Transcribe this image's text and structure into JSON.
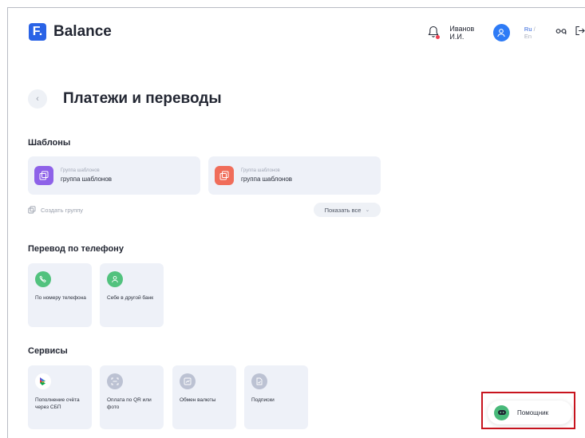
{
  "header": {
    "logo_letter": "F.",
    "logo_text": "Balance",
    "user_name": "Иванов И.И.",
    "lang_active": "Ru",
    "lang_sep": "/",
    "lang_inactive": "En"
  },
  "page": {
    "back_glyph": "‹",
    "title": "Платежи и переводы"
  },
  "templates": {
    "section_title": "Шаблоны",
    "cards": [
      {
        "sublabel": "Группа шаблонов",
        "label": "группа шаблонов",
        "icon": "template-group-icon",
        "color": "#8e62e8"
      },
      {
        "sublabel": "Группа шаблонов",
        "label": "группа шаблонов",
        "icon": "template-group-icon",
        "color": "#f06d5a"
      }
    ],
    "create_group": "Создать группу",
    "show_all": "Показать все"
  },
  "phone_transfer": {
    "section_title": "Перевод по телефону",
    "tiles": [
      {
        "label": "По номеру телефона",
        "icon": "phone-icon",
        "color": "#52c27e"
      },
      {
        "label": "Себе в другой банк",
        "icon": "user-icon",
        "color": "#52c27e"
      }
    ]
  },
  "services": {
    "section_title": "Сервисы",
    "tiles": [
      {
        "label": "Пополнение счёта через СБП",
        "icon": "sbp-icon"
      },
      {
        "label": "Оплата по QR или фото",
        "icon": "qr-scan-icon"
      },
      {
        "label": "Обмен валюты",
        "icon": "currency-exchange-icon"
      },
      {
        "label": "Подписки",
        "icon": "subscription-icon"
      }
    ]
  },
  "assistant": {
    "label": "Помощник",
    "icon": "robot-icon"
  }
}
